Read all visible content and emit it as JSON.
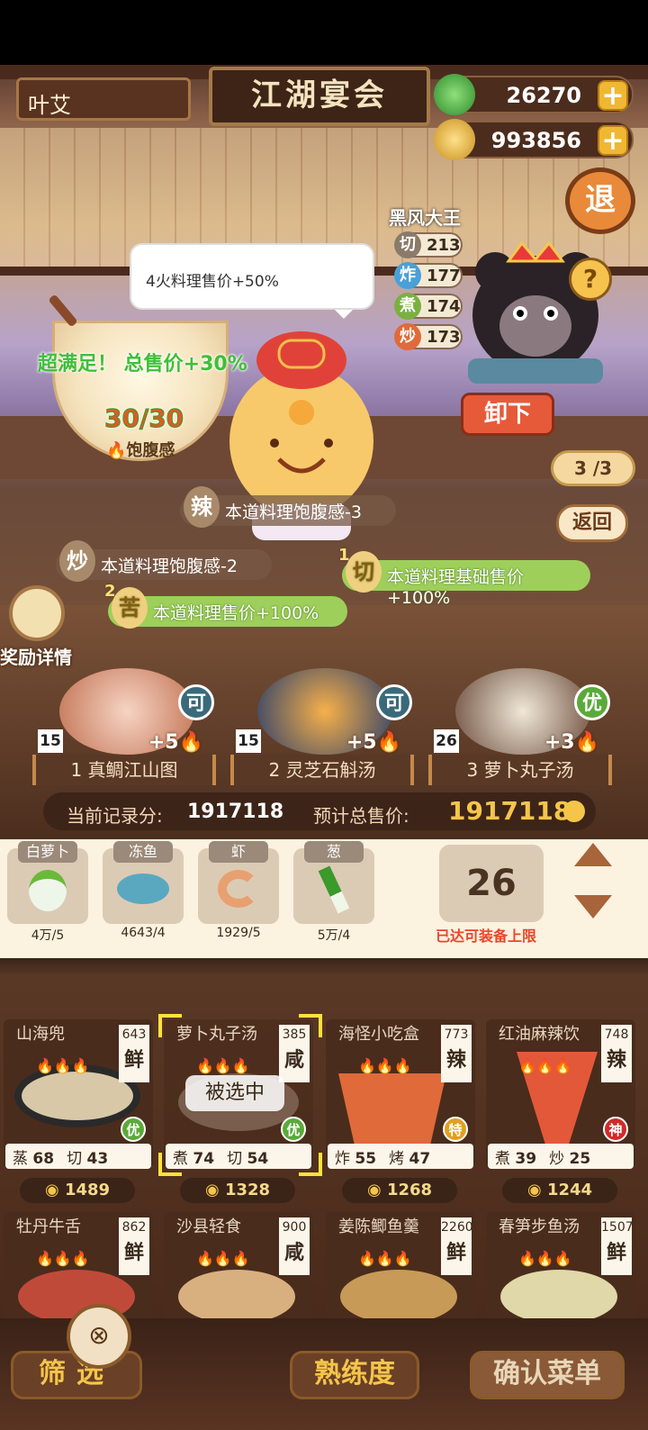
{
  "header": {
    "player_name": "叶艾",
    "sign_title": "江湖宴会",
    "jade": "26270",
    "coins": "993856",
    "exit_label": "退"
  },
  "boss": {
    "name": "黑风大王",
    "stats": [
      {
        "skill": "切",
        "value": "213",
        "color": "#8a7a6a"
      },
      {
        "skill": "炸",
        "value": "177",
        "color": "#4aa0d8"
      },
      {
        "skill": "煮",
        "value": "174",
        "color": "#7ab040"
      },
      {
        "skill": "炒",
        "value": "173",
        "color": "#e06a3a"
      }
    ],
    "unequip_label": "卸下",
    "help_label": "?"
  },
  "bubble": {
    "tip": "4火料理售价+50%"
  },
  "bowl": {
    "satisfied": "超满足！ 总售价+30%",
    "fullness": "30/30",
    "fullness_label": "饱腹感"
  },
  "buffs": [
    {
      "icon": "辣",
      "num": "",
      "text": "本道料理饱腹感-3"
    },
    {
      "icon": "炒",
      "num": "",
      "text": "本道料理饱腹感-2"
    },
    {
      "icon": "切",
      "num": "1",
      "text": "本道料理基础售价+100%"
    },
    {
      "icon": "苦",
      "num": "2",
      "text": "本道料理售价+100%"
    }
  ],
  "nav": {
    "page": "3 /3",
    "back_label": "返回"
  },
  "reward_label": "奖励详情",
  "slots": [
    {
      "index": "1",
      "name": "真鲷江山图",
      "count": "15",
      "bonus": "+5",
      "badge": "可",
      "badge_color": "#3a6a7a"
    },
    {
      "index": "2",
      "name": "灵芝石斛汤",
      "count": "15",
      "bonus": "+5",
      "badge": "可",
      "badge_color": "#3a6a7a"
    },
    {
      "index": "3",
      "name": "萝卜丸子汤",
      "count": "26",
      "bonus": "+3",
      "badge": "优",
      "badge_color": "#5aaa3a"
    }
  ],
  "score": {
    "record_label": "当前记录分:",
    "record_value": "1917118",
    "total_label": "预计总售价:",
    "total_value": "1917118"
  },
  "ingredients": [
    {
      "name": "白萝卜",
      "count": "4万/5",
      "icon": "radish-icon"
    },
    {
      "name": "冻鱼",
      "count": "4643/4",
      "icon": "fish-icon"
    },
    {
      "name": "虾",
      "count": "1929/5",
      "icon": "shrimp-icon"
    },
    {
      "name": "葱",
      "count": "5万/4",
      "icon": "scallion-icon"
    }
  ],
  "capacity": {
    "value": "26",
    "note": "已达可装备上限"
  },
  "recipes": [
    {
      "name": "山海兜",
      "points": "643",
      "flavor": "鲜",
      "s1k": "蒸",
      "s1v": "68",
      "s2k": "切",
      "s2v": "43",
      "price": "1489",
      "rank": "优",
      "rank_color": "#5aaa3a",
      "img": "#d8c8a8"
    },
    {
      "name": "萝卜丸子汤",
      "points": "385",
      "flavor": "咸",
      "s1k": "煮",
      "s1v": "74",
      "s2k": "切",
      "s2v": "54",
      "price": "1328",
      "rank": "优",
      "rank_color": "#5aaa3a",
      "img": "#8a7060",
      "selected": "被选中"
    },
    {
      "name": "海怪小吃盒",
      "points": "773",
      "flavor": "辣",
      "s1k": "炸",
      "s1v": "55",
      "s2k": "烤",
      "s2v": "47",
      "price": "1268",
      "rank": "特",
      "rank_color": "#e0a020",
      "img": "#e06a3a"
    },
    {
      "name": "红油麻辣饮",
      "points": "748",
      "flavor": "辣",
      "s1k": "煮",
      "s1v": "39",
      "s2k": "炒",
      "s2v": "25",
      "price": "1244",
      "rank": "神",
      "rank_color": "#d02a2a",
      "img": "#e4583a"
    },
    {
      "name": "牡丹牛舌",
      "points": "862",
      "flavor": "鲜",
      "img": "#c04a3a"
    },
    {
      "name": "沙县轻食",
      "points": "900",
      "flavor": "咸",
      "img": "#d8b080"
    },
    {
      "name": "姜陈鲫鱼羹",
      "points": "2260",
      "flavor": "鲜",
      "img": "#c89a58"
    },
    {
      "name": "春笋步鱼汤",
      "points": "1507",
      "flavor": "鲜",
      "img": "#e0d8a8"
    }
  ],
  "bottom": {
    "filter_label": "筛选",
    "proficiency_label": "熟练度",
    "confirm_label": "确认菜单"
  }
}
